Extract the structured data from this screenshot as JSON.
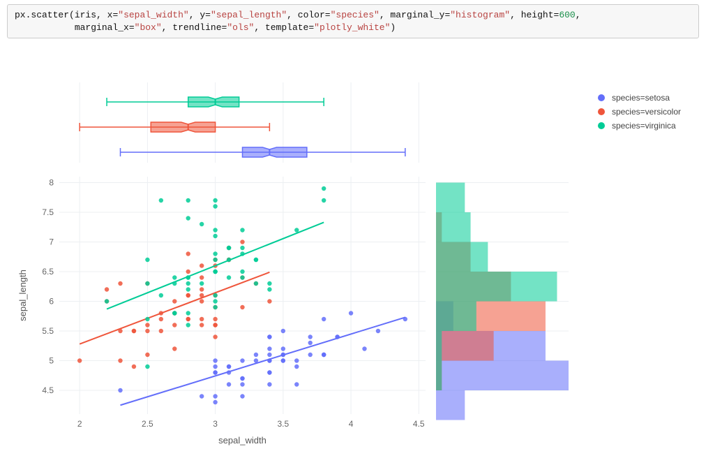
{
  "code_cell": {
    "fn": "px.scatter",
    "args": [
      {
        "name": "",
        "raw": "iris"
      },
      {
        "name": "x",
        "value": "sepal_width"
      },
      {
        "name": "y",
        "value": "sepal_length"
      },
      {
        "name": "color",
        "value": "species"
      },
      {
        "name": "marginal_y",
        "value": "histogram"
      },
      {
        "name": "height",
        "value": 600,
        "is_num": true
      },
      {
        "name": "marginal_x",
        "value": "box"
      },
      {
        "name": "trendline",
        "value": "ols"
      },
      {
        "name": "template",
        "value": "plotly_white"
      }
    ]
  },
  "legend": {
    "entries": [
      {
        "key": "setosa",
        "label": "species=setosa",
        "color": "#636efa"
      },
      {
        "key": "versicolor",
        "label": "species=versicolor",
        "color": "#ef553b"
      },
      {
        "key": "virginica",
        "label": "species=virginica",
        "color": "#00cc96"
      }
    ]
  },
  "chart_data": {
    "type": "scatter",
    "xlabel": "sepal_width",
    "ylabel": "sepal_length",
    "x_ticks": [
      2,
      2.5,
      3,
      3.5,
      4,
      4.5
    ],
    "y_ticks": [
      4.5,
      5,
      5.5,
      6,
      6.5,
      7,
      7.5,
      8
    ],
    "xlim": [
      1.85,
      4.55
    ],
    "ylim": [
      4.1,
      8.1
    ],
    "template": "plotly_white",
    "trendline": "ols",
    "marginal_x": "box",
    "marginal_y": "histogram",
    "series": [
      {
        "name": "setosa",
        "color": "#636efa",
        "points": [
          [
            3.5,
            5.1
          ],
          [
            3.0,
            4.9
          ],
          [
            3.2,
            4.7
          ],
          [
            3.1,
            4.6
          ],
          [
            3.6,
            5.0
          ],
          [
            3.9,
            5.4
          ],
          [
            3.4,
            4.6
          ],
          [
            3.4,
            5.0
          ],
          [
            2.9,
            4.4
          ],
          [
            3.1,
            4.9
          ],
          [
            3.7,
            5.4
          ],
          [
            3.4,
            4.8
          ],
          [
            3.0,
            4.8
          ],
          [
            3.0,
            4.3
          ],
          [
            4.0,
            5.8
          ],
          [
            4.4,
            5.7
          ],
          [
            3.9,
            5.4
          ],
          [
            3.5,
            5.1
          ],
          [
            3.8,
            5.7
          ],
          [
            3.8,
            5.1
          ],
          [
            3.4,
            5.4
          ],
          [
            3.7,
            5.1
          ],
          [
            3.6,
            4.6
          ],
          [
            3.3,
            5.1
          ],
          [
            3.4,
            4.8
          ],
          [
            3.0,
            5.0
          ],
          [
            3.4,
            5.0
          ],
          [
            3.5,
            5.2
          ],
          [
            3.4,
            5.2
          ],
          [
            3.2,
            4.7
          ],
          [
            3.1,
            4.8
          ],
          [
            3.4,
            5.4
          ],
          [
            4.1,
            5.2
          ],
          [
            4.2,
            5.5
          ],
          [
            3.1,
            4.9
          ],
          [
            3.2,
            5.0
          ],
          [
            3.5,
            5.5
          ],
          [
            3.6,
            4.9
          ],
          [
            3.0,
            4.4
          ],
          [
            3.4,
            5.1
          ],
          [
            3.5,
            5.0
          ],
          [
            2.3,
            4.5
          ],
          [
            3.2,
            4.4
          ],
          [
            3.5,
            5.0
          ],
          [
            3.8,
            5.1
          ],
          [
            3.0,
            4.8
          ],
          [
            3.8,
            5.1
          ],
          [
            3.2,
            4.6
          ],
          [
            3.7,
            5.3
          ],
          [
            3.3,
            5.0
          ]
        ],
        "trendline_points": [
          [
            2.3,
            4.25
          ],
          [
            4.4,
            5.73
          ]
        ],
        "box": {
          "q1": 3.2,
          "median": 3.4,
          "q3": 3.675,
          "whisker_low": 2.3,
          "whisker_high": 4.4
        },
        "histogram_y": {
          "bins": [
            4.0,
            4.5,
            5.0,
            5.5,
            6.0
          ],
          "counts": [
            5,
            23,
            19,
            3
          ]
        }
      },
      {
        "name": "versicolor",
        "color": "#ef553b",
        "points": [
          [
            3.2,
            7.0
          ],
          [
            3.2,
            6.4
          ],
          [
            3.1,
            6.9
          ],
          [
            2.3,
            5.5
          ],
          [
            2.8,
            6.5
          ],
          [
            2.8,
            5.7
          ],
          [
            3.3,
            6.3
          ],
          [
            2.4,
            4.9
          ],
          [
            2.9,
            6.6
          ],
          [
            2.7,
            5.2
          ],
          [
            2.0,
            5.0
          ],
          [
            3.0,
            5.9
          ],
          [
            2.2,
            6.0
          ],
          [
            2.9,
            6.1
          ],
          [
            2.9,
            5.6
          ],
          [
            3.1,
            6.7
          ],
          [
            3.0,
            5.6
          ],
          [
            2.7,
            5.8
          ],
          [
            2.2,
            6.2
          ],
          [
            2.5,
            5.6
          ],
          [
            3.2,
            5.9
          ],
          [
            2.8,
            6.1
          ],
          [
            2.5,
            6.3
          ],
          [
            2.8,
            6.1
          ],
          [
            2.9,
            6.4
          ],
          [
            3.0,
            6.6
          ],
          [
            2.8,
            6.8
          ],
          [
            3.0,
            6.7
          ],
          [
            2.9,
            6.0
          ],
          [
            2.6,
            5.7
          ],
          [
            2.4,
            5.5
          ],
          [
            2.4,
            5.5
          ],
          [
            2.7,
            5.8
          ],
          [
            2.7,
            6.0
          ],
          [
            3.0,
            5.4
          ],
          [
            3.4,
            6.0
          ],
          [
            3.1,
            6.7
          ],
          [
            2.3,
            6.3
          ],
          [
            3.0,
            5.6
          ],
          [
            2.5,
            5.5
          ],
          [
            2.6,
            5.5
          ],
          [
            3.0,
            6.1
          ],
          [
            2.6,
            5.8
          ],
          [
            2.3,
            5.0
          ],
          [
            2.7,
            5.6
          ],
          [
            3.0,
            5.7
          ],
          [
            2.9,
            5.7
          ],
          [
            2.9,
            6.2
          ],
          [
            2.5,
            5.1
          ],
          [
            2.8,
            5.7
          ]
        ],
        "trendline_points": [
          [
            2.0,
            5.28
          ],
          [
            3.4,
            6.49
          ]
        ],
        "box": {
          "q1": 2.525,
          "median": 2.8,
          "q3": 3.0,
          "whisker_low": 2.0,
          "whisker_high": 3.4
        },
        "histogram_y": {
          "bins": [
            4.5,
            5.0,
            5.5,
            6.0,
            6.5,
            7.0,
            7.5
          ],
          "counts": [
            1,
            10,
            19,
            13,
            6,
            1
          ]
        }
      },
      {
        "name": "virginica",
        "color": "#00cc96",
        "points": [
          [
            3.3,
            6.3
          ],
          [
            2.7,
            5.8
          ],
          [
            3.0,
            7.1
          ],
          [
            2.9,
            6.3
          ],
          [
            3.0,
            6.5
          ],
          [
            3.0,
            7.6
          ],
          [
            2.5,
            4.9
          ],
          [
            2.9,
            7.3
          ],
          [
            2.5,
            6.7
          ],
          [
            3.6,
            7.2
          ],
          [
            3.2,
            6.5
          ],
          [
            2.7,
            6.4
          ],
          [
            3.0,
            6.8
          ],
          [
            2.5,
            5.7
          ],
          [
            2.8,
            5.8
          ],
          [
            3.2,
            6.4
          ],
          [
            3.0,
            6.5
          ],
          [
            3.8,
            7.7
          ],
          [
            2.6,
            7.7
          ],
          [
            2.2,
            6.0
          ],
          [
            3.2,
            6.9
          ],
          [
            2.8,
            5.6
          ],
          [
            2.8,
            7.7
          ],
          [
            2.7,
            6.3
          ],
          [
            3.3,
            6.7
          ],
          [
            3.2,
            7.2
          ],
          [
            2.8,
            6.2
          ],
          [
            3.0,
            6.1
          ],
          [
            2.8,
            6.4
          ],
          [
            3.0,
            7.2
          ],
          [
            2.8,
            7.4
          ],
          [
            3.8,
            7.9
          ],
          [
            2.8,
            6.4
          ],
          [
            2.8,
            6.3
          ],
          [
            2.6,
            6.1
          ],
          [
            3.0,
            7.7
          ],
          [
            3.4,
            6.3
          ],
          [
            3.1,
            6.4
          ],
          [
            3.0,
            6.0
          ],
          [
            3.1,
            6.9
          ],
          [
            3.1,
            6.7
          ],
          [
            3.1,
            6.9
          ],
          [
            2.7,
            5.8
          ],
          [
            3.2,
            6.8
          ],
          [
            3.3,
            6.7
          ],
          [
            3.0,
            6.7
          ],
          [
            2.5,
            6.3
          ],
          [
            3.0,
            6.5
          ],
          [
            3.4,
            6.2
          ],
          [
            3.0,
            5.9
          ]
        ],
        "trendline_points": [
          [
            2.2,
            5.87
          ],
          [
            3.8,
            7.33
          ]
        ],
        "box": {
          "q1": 2.8,
          "median": 3.0,
          "q3": 3.175,
          "whisker_low": 2.2,
          "whisker_high": 3.8
        },
        "histogram_y": {
          "bins": [
            4.5,
            5.0,
            5.5,
            6.0,
            6.5,
            7.0,
            7.5,
            8.0
          ],
          "counts": [
            1,
            1,
            7,
            21,
            9,
            6,
            5
          ]
        }
      }
    ]
  }
}
